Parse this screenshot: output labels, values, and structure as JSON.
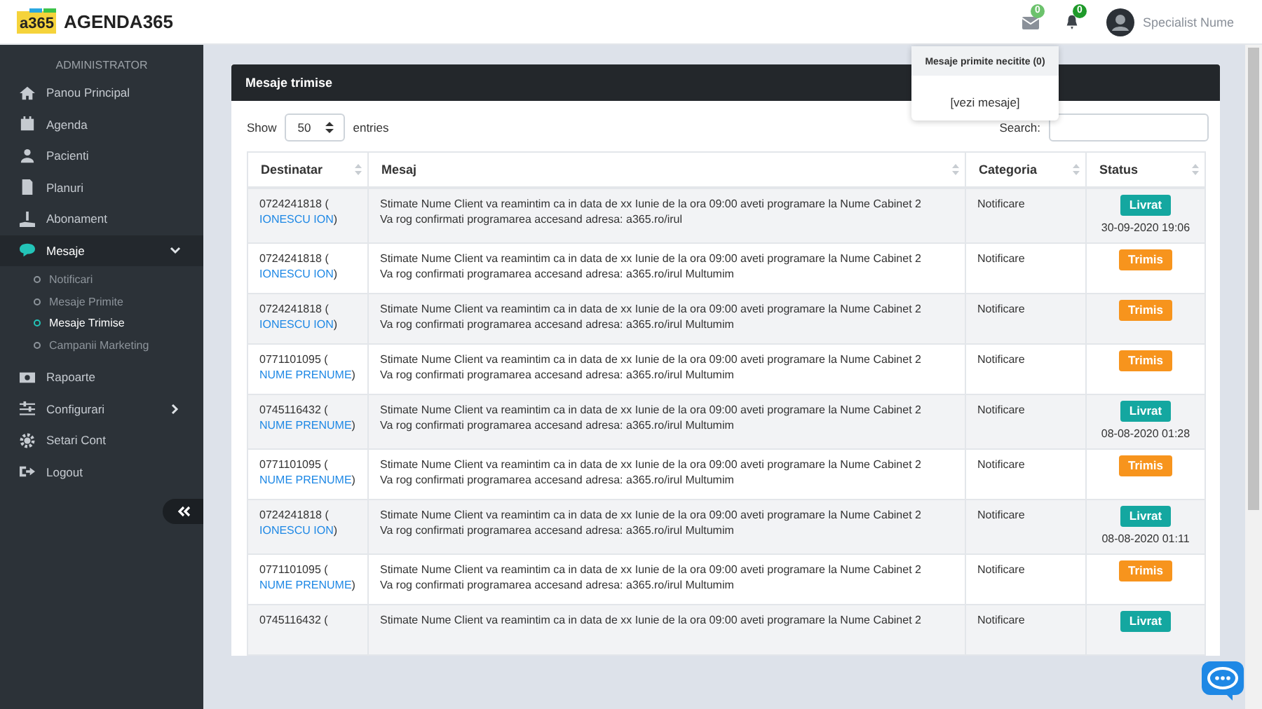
{
  "header": {
    "logo_mark": "a365",
    "brand": "AGENDA365",
    "messages_badge": "0",
    "notifications_badge": "0",
    "user_name": "Specialist Nume"
  },
  "dropdown": {
    "title": "Mesaje primite necitite (0)",
    "link": "[vezi mesaje]"
  },
  "sidebar": {
    "section": "ADMINISTRATOR",
    "items": [
      {
        "label": "Panou Principal",
        "selected": false
      },
      {
        "label": "Agenda",
        "selected": false
      },
      {
        "label": "Pacienti",
        "selected": false
      },
      {
        "label": "Planuri",
        "selected": false
      },
      {
        "label": "Abonament",
        "selected": false
      },
      {
        "label": "Mesaje",
        "selected": true,
        "expanded": true,
        "children": [
          {
            "label": "Notificari",
            "selected": false
          },
          {
            "label": "Mesaje Primite",
            "selected": false
          },
          {
            "label": "Mesaje Trimise",
            "selected": true
          },
          {
            "label": "Campanii Marketing",
            "selected": false
          }
        ]
      },
      {
        "label": "Rapoarte",
        "selected": false
      },
      {
        "label": "Configurari",
        "selected": false,
        "expanded": false
      },
      {
        "label": "Setari Cont",
        "selected": false
      },
      {
        "label": "Logout",
        "selected": false
      }
    ]
  },
  "card": {
    "title": "Mesaje trimise",
    "show_label": "Show",
    "page_size": "50",
    "entries_label": "entries",
    "search_label": "Search:",
    "columns": [
      "Destinatar",
      "Mesaj",
      "Categoria",
      "Status"
    ],
    "rows": [
      {
        "phone": "0724241818 (",
        "name": "IONESCU ION",
        "close": ")",
        "message": [
          "Stimate Nume Client va reamintim ca in data de xx Iunie de la ora 09:00 aveti programare la Nume Cabinet 2",
          "Va rog confirmati programarea accesand adresa: a365.ro/irul"
        ],
        "category": "Notificare",
        "kind": "delivered",
        "status": "Livrat",
        "date": "30-09-2020 19:06"
      },
      {
        "phone": "0724241818 (",
        "name": "IONESCU ION",
        "close": ")",
        "message": [
          "Stimate Nume Client va reamintim ca in data de xx Iunie de la ora 09:00 aveti programare la Nume Cabinet 2",
          "Va rog confirmati programarea accesand adresa: a365.ro/irul Multumim"
        ],
        "category": "Notificare",
        "kind": "sent",
        "status": "Trimis"
      },
      {
        "phone": "0724241818 (",
        "name": "IONESCU ION",
        "close": ")",
        "message": [
          "Stimate Nume Client va reamintim ca in data de xx Iunie de la ora 09:00 aveti programare la Nume Cabinet 2",
          "Va rog confirmati programarea accesand adresa: a365.ro/irul Multumim"
        ],
        "category": "Notificare",
        "kind": "sent",
        "status": "Trimis"
      },
      {
        "phone": "0771101095 (",
        "name": "NUME PRENUME",
        "close": ")",
        "message": [
          "Stimate Nume Client va reamintim ca in data de xx Iunie de la ora 09:00 aveti programare la Nume Cabinet 2",
          "Va rog confirmati programarea accesand adresa: a365.ro/irul Multumim"
        ],
        "category": "Notificare",
        "kind": "sent",
        "status": "Trimis"
      },
      {
        "phone": "0745116432 (",
        "name": "NUME PRENUME",
        "close": ")",
        "message": [
          "Stimate Nume Client va reamintim ca in data de xx Iunie de la ora 09:00 aveti programare la Nume Cabinet 2",
          "Va rog confirmati programarea accesand adresa: a365.ro/irul Multumim"
        ],
        "category": "Notificare",
        "kind": "delivered",
        "status": "Livrat",
        "date": "08-08-2020 01:28"
      },
      {
        "phone": "0771101095 (",
        "name": "NUME PRENUME",
        "close": ")",
        "message": [
          "Stimate Nume Client va reamintim ca in data de xx Iunie de la ora 09:00 aveti programare la Nume Cabinet 2",
          "Va rog confirmati programarea accesand adresa: a365.ro/irul Multumim"
        ],
        "category": "Notificare",
        "kind": "sent",
        "status": "Trimis"
      },
      {
        "phone": "0724241818 (",
        "name": "IONESCU ION",
        "close": ")",
        "message": [
          "Stimate Nume Client va reamintim ca in data de xx Iunie de la ora 09:00 aveti programare la Nume Cabinet 2",
          "Va rog confirmati programarea accesand adresa: a365.ro/irul Multumim"
        ],
        "category": "Notificare",
        "kind": "delivered",
        "status": "Livrat",
        "date": "08-08-2020 01:11"
      },
      {
        "phone": "0771101095 (",
        "name": "NUME PRENUME",
        "close": ")",
        "message": [
          "Stimate Nume Client va reamintim ca in data de xx Iunie de la ora 09:00 aveti programare la Nume Cabinet 2",
          "Va rog confirmati programarea accesand adresa: a365.ro/irul Multumim"
        ],
        "category": "Notificare",
        "kind": "sent",
        "status": "Trimis"
      },
      {
        "phone": "0745116432 (",
        "message": [
          "Stimate Nume Client va reamintim ca in data de xx Iunie de la ora 09:00 aveti programare la Nume Cabinet 2"
        ],
        "category": "Notificare",
        "kind": "delivered",
        "status": "Livrat"
      }
    ]
  }
}
